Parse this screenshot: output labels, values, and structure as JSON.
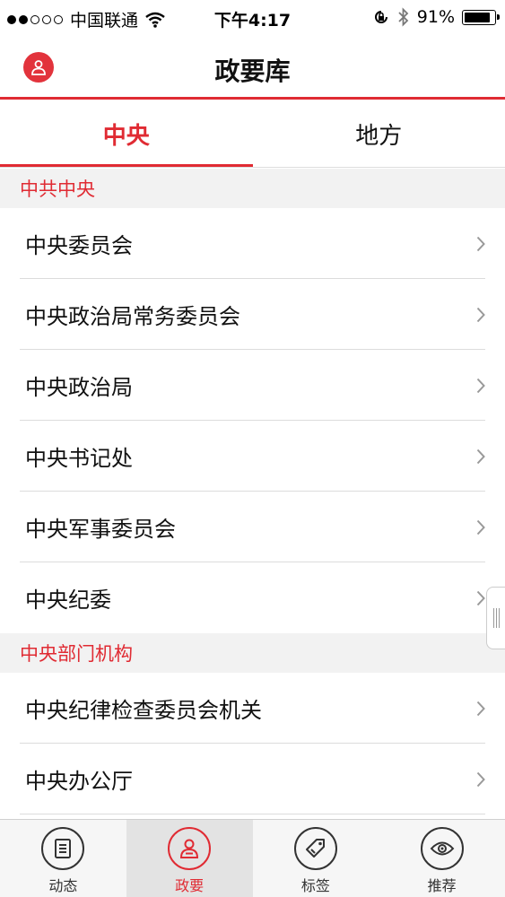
{
  "status_bar": {
    "carrier": "中国联通",
    "time": "下午4:17",
    "battery": "91%",
    "battery_level": 0.91
  },
  "nav": {
    "title": "政要库",
    "avatar_icon": "user-icon"
  },
  "tabs": [
    {
      "label": "中央",
      "active": true
    },
    {
      "label": "地方",
      "active": false
    }
  ],
  "sections": [
    {
      "header": "中共中央",
      "items": [
        "中央委员会",
        "中央政治局常务委员会",
        "中央政治局",
        "中央书记处",
        "中央军事委员会",
        "中央纪委"
      ]
    },
    {
      "header": "中央部门机构",
      "items": [
        "中央纪律检查委员会机关",
        "中央办公厅"
      ]
    }
  ],
  "tab_bar": [
    {
      "label": "动态",
      "icon": "document-icon",
      "active": false
    },
    {
      "label": "政要",
      "icon": "person-icon",
      "active": true
    },
    {
      "label": "标签",
      "icon": "tag-icon",
      "active": false
    },
    {
      "label": "推荐",
      "icon": "eye-icon",
      "active": false
    }
  ],
  "colors": {
    "accent": "#e02b33",
    "section_bg": "#f2f2f2"
  }
}
